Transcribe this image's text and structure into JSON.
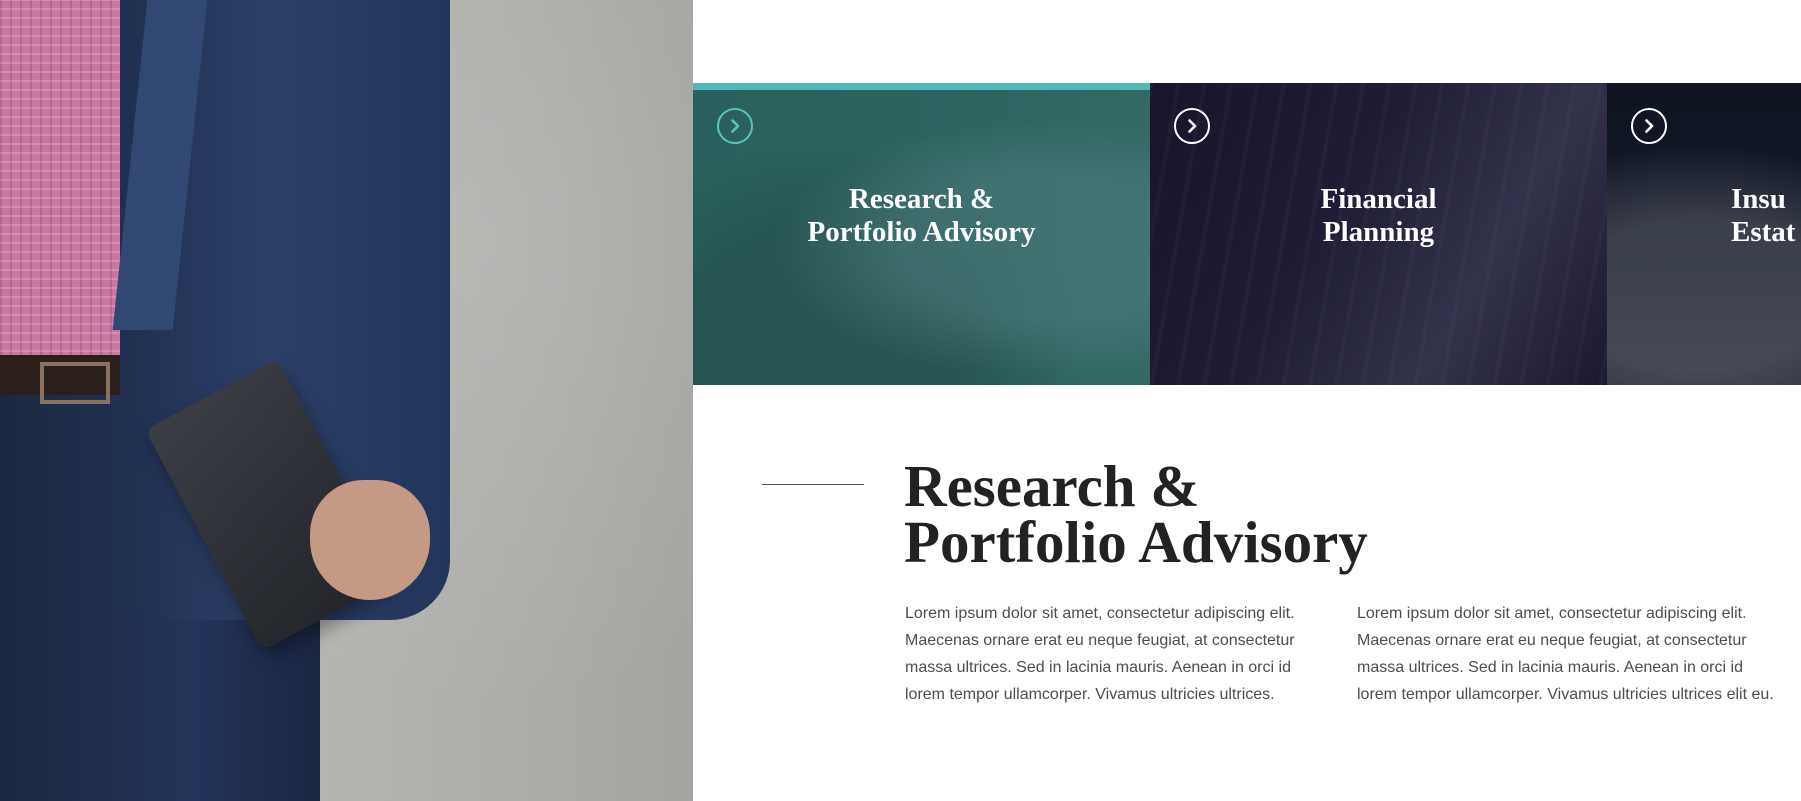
{
  "colors": {
    "accent": "#4dbab8",
    "heading": "#222222",
    "body_text": "#4d4d4d",
    "tile_research": "#2a5a58"
  },
  "services": [
    {
      "title_line1": "Research &",
      "title_line2": "Portfolio Advisory",
      "icon": "chevron-right-circle-icon",
      "active": true
    },
    {
      "title_line1": "Financial",
      "title_line2": "Planning",
      "icon": "chevron-right-circle-icon",
      "active": false
    },
    {
      "title_line1": "Insu",
      "title_line2": "Estat",
      "icon": "chevron-right-circle-icon",
      "active": false
    }
  ],
  "detail": {
    "heading_line1": "Research &",
    "heading_line2": "Portfolio Advisory",
    "column1": "Lorem ipsum dolor sit amet, consectetur adipiscing elit. Maecenas ornare erat eu neque feugiat, at consectetur massa ultrices. Sed in lacinia mauris. Aenean in orci id lorem tempor ullamcorper. Vivamus ultricies ultrices.",
    "column2": "Lorem ipsum dolor sit amet, consectetur adipiscing elit. Maecenas ornare erat eu neque feugiat, at consectetur massa ultrices. Sed in lacinia mauris. Aenean in orci id lorem tempor ullamcorper. Vivamus ultricies ultrices elit eu."
  }
}
